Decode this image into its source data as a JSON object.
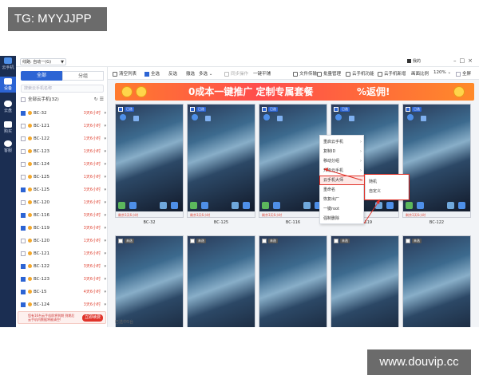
{
  "watermarks": {
    "top_left": "TG: MYYJJPP",
    "bottom_right": "www.douvip.cc"
  },
  "colors": {
    "accent": "#2c64d4",
    "rail": "#1b2e52",
    "banner": "#ff5a3a",
    "alert": "#e0332a"
  },
  "titlebar": {
    "route": "线路: 自动一(G)",
    "user": "我的"
  },
  "left_rail": [
    {
      "icon": "logo-icon",
      "label": "云手机"
    },
    {
      "icon": "phone-icon",
      "label": "设备"
    },
    {
      "icon": "cloud-icon",
      "label": "云盘"
    },
    {
      "icon": "cart-icon",
      "label": "购买"
    },
    {
      "icon": "headset-icon",
      "label": "客服"
    }
  ],
  "sidebar": {
    "tab_all": "全部",
    "tab_group": "分组",
    "search_placeholder": "搜索云手机名称",
    "group_label": "全部云手机(32)",
    "devices": [
      {
        "name": "BC-32",
        "remain": "3天6小时",
        "checked": true
      },
      {
        "name": "BC-121",
        "remain": "1天6小时",
        "checked": false
      },
      {
        "name": "BC-122",
        "remain": "1天6小时",
        "checked": false
      },
      {
        "name": "BC-123",
        "remain": "1天6小时",
        "checked": false
      },
      {
        "name": "BC-124",
        "remain": "1天6小时",
        "checked": false
      },
      {
        "name": "BC-125",
        "remain": "1天6小时",
        "checked": false
      },
      {
        "name": "BC-125",
        "remain": "3天6小时",
        "checked": true
      },
      {
        "name": "BC-120",
        "remain": "1天6小时",
        "checked": false
      },
      {
        "name": "BC-116",
        "remain": "3天6小时",
        "checked": true
      },
      {
        "name": "BC-119",
        "remain": "3天6小时",
        "checked": true
      },
      {
        "name": "BC-120",
        "remain": "1天6小时",
        "checked": false
      },
      {
        "name": "BC-121",
        "remain": "1天6小时",
        "checked": false
      },
      {
        "name": "BC-122",
        "remain": "3天6小时",
        "checked": true
      },
      {
        "name": "BC-123",
        "remain": "3天6小时",
        "checked": true
      },
      {
        "name": "BC-15",
        "remain": "4天6小时",
        "checked": true
      },
      {
        "name": "BC-124",
        "remain": "3天6小时",
        "checked": true
      }
    ],
    "promo_text": "您有16台云手机即将到期 到期后云手机内数据将被清空!",
    "promo_button": "立即续费"
  },
  "toolbar": {
    "refresh": "清空列表",
    "select_all": "全选",
    "invert": "反选",
    "deselect": "撤选",
    "multi_select": "多选",
    "sync_op": "同步操作",
    "one_key_flat": "一键平铺",
    "file_transfer": "文件传输",
    "batch_manage": "批量管理",
    "cloud_phone_start": "云手机功能",
    "cloud_phone_new": "云手机新增",
    "display_ratio": "画面比例",
    "ratio_value": "120%",
    "fullscreen": "全屏"
  },
  "banner": {
    "text_left": "0成本一键推广 定制专属套餐",
    "text_right": "%返佣!"
  },
  "phones": [
    {
      "name": "BC-32",
      "checked": true,
      "tag": "已选",
      "expire": "剩余3天6小时"
    },
    {
      "name": "BC-125",
      "checked": true,
      "tag": "已选",
      "expire": "剩余3天6小时"
    },
    {
      "name": "BC-116",
      "checked": true,
      "tag": "已选",
      "expire": "剩余3天6小时"
    },
    {
      "name": "BC-119",
      "checked": true,
      "tag": "已选",
      "expire": "剩余3天6小时"
    },
    {
      "name": "BC-122",
      "checked": true,
      "tag": "已选",
      "expire": "剩余3天6小时"
    },
    {
      "name": "",
      "checked": false,
      "tag": "未选",
      "expire": ""
    },
    {
      "name": "",
      "checked": false,
      "tag": "未选",
      "expire": ""
    },
    {
      "name": "",
      "checked": false,
      "tag": "未选",
      "expire": ""
    },
    {
      "name": "",
      "checked": false,
      "tag": "未选",
      "expire": ""
    },
    {
      "name": "",
      "checked": false,
      "tag": "未选",
      "expire": ""
    }
  ],
  "footer_note": "已选中5台",
  "context_menu": {
    "items": [
      "重启云手机",
      "复制ID",
      "移动分组",
      "升级云手机",
      "云手机大师",
      "重命名",
      "恢复出厂",
      "一键root",
      "强制删除"
    ],
    "highlight_index": 4,
    "submenu": [
      "随机",
      "自定义"
    ]
  }
}
